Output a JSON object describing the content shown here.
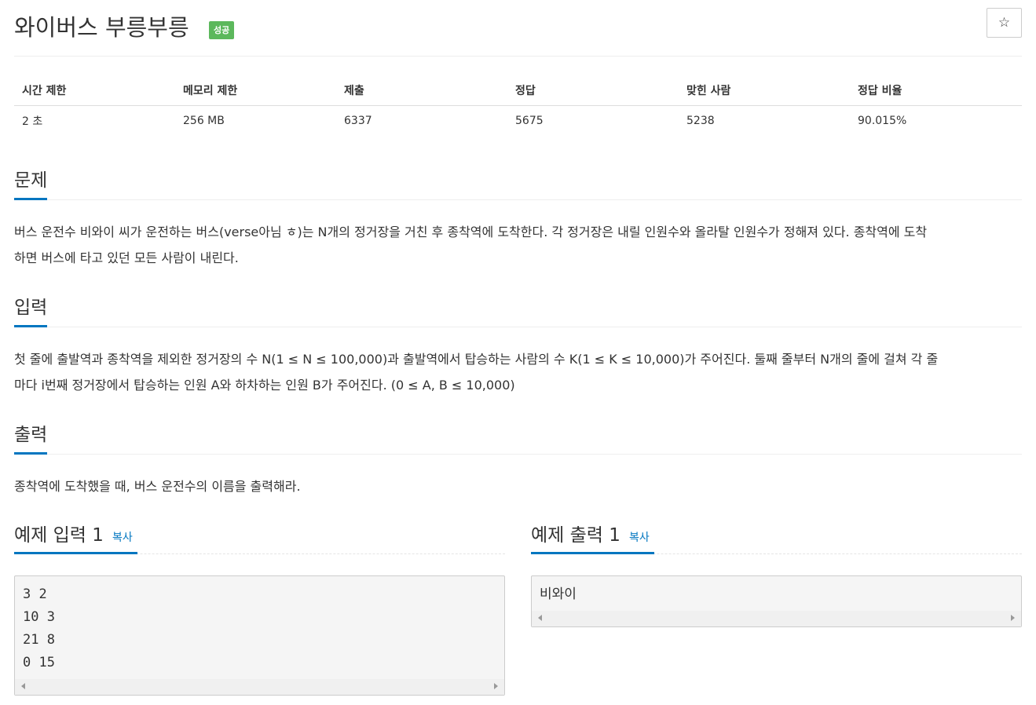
{
  "problem": {
    "title": "와이버스 부릉부릉",
    "badge": "성공",
    "star_icon": "☆"
  },
  "info_table": {
    "headers": [
      "시간 제한",
      "메모리 제한",
      "제출",
      "정답",
      "맞힌 사람",
      "정답 비율"
    ],
    "values": [
      "2 초",
      "256 MB",
      "6337",
      "5675",
      "5238",
      "90.015%"
    ]
  },
  "sections": {
    "problem": {
      "heading": "문제",
      "line1": "버스 운전수 비와이 씨가 운전하는 버스(verse아님 ㅎ)는 N개의 정거장을 거친 후 종착역에 도착한다. 각 정거장은 내릴 인원수와 올라탈 인원수가 정해져 있다. 종착역에 도착",
      "line2": "하면 버스에 타고 있던 모든 사람이 내린다."
    },
    "input": {
      "heading": "입력",
      "line1": "첫 줄에 출발역과 종착역을 제외한 정거장의 수 N(1 ≤ N ≤ 100,000)과 출발역에서 탑승하는 사람의 수 K(1 ≤ K ≤ 10,000)가 주어진다. 둘째 줄부터 N개의 줄에 걸쳐 각 줄",
      "line2": "마다 i번째 정거장에서 탑승하는 인원 A와 하차하는 인원 B가 주어진다. (0 ≤ A, B ≤ 10,000)"
    },
    "output": {
      "heading": "출력",
      "line1": "종착역에 도착했을 때, 버스 운전수의 이름을 출력해라."
    }
  },
  "samples": {
    "input": {
      "heading": "예제 입력 1",
      "copy": "복사",
      "lines": [
        "3 2",
        "10 3",
        "21 8",
        "0 15"
      ]
    },
    "output": {
      "heading": "예제 출력 1",
      "copy": "복사",
      "lines": [
        "비와이"
      ]
    }
  },
  "colors": {
    "accent": "#0076c0",
    "badge": "#5cb85c"
  }
}
